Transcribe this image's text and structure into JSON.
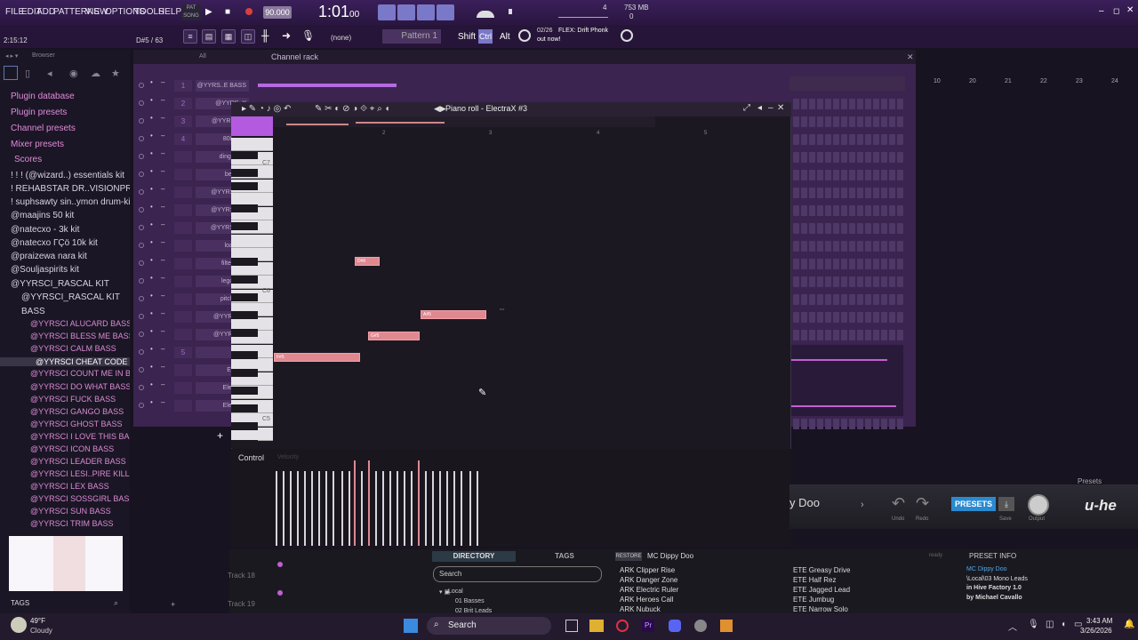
{
  "menu": [
    "FILE",
    "EDIT",
    "ADD",
    "PATTERNS",
    "VIEW",
    "OPTIONS",
    "TOOLS",
    "HELP"
  ],
  "transport": {
    "tempo": "90.000",
    "time": "1:01",
    "time_sub": "00",
    "pattern": "Pattern 1",
    "cpu": "753 MB",
    "cpu2": "0",
    "voices": "4",
    "hint_count": "02/26",
    "hint_text": "FLEX: Drift Phonk",
    "hint_sub": "out now!",
    "shift": "Shift",
    "ctrl": "Ctrl",
    "alt": "Alt",
    "none": "(none)",
    "song_time": "2:15:12",
    "key_pos": "D#5 / 63",
    "pat_label": "PAT",
    "song_label": "SONG"
  },
  "browser": {
    "title": "Browser",
    "all": "All",
    "items": [
      "Plugin database",
      "Plugin presets",
      "Channel presets",
      "Mixer presets",
      "Scores",
      "! ! ! (@wizard..) essentials kit",
      "! REHABSTAR DR..VISIONPROD1",
      "! suphsawty sin..ymon drum-kit",
      "@maajins 50 kit",
      "@natecxo - 3k kit",
      "@natecxo ГÇö 10k kit",
      "@praizewa nara kit",
      "@Souljaspirits kit",
      "@YYRSCI_RASCAL KIT",
      "@YYRSCI_RASCAL KIT",
      "BASS",
      "@YYRSCI ALUCARD BASS",
      "@YYRSCI BLESS ME BASS",
      "@YYRSCI CALM BASS",
      "@YYRSCI CHEAT CODE BASS",
      "@YYRSCI COUNT ME IN BASS",
      "@YYRSCI DO WHAT BASS",
      "@YYRSCI FUCK BASS",
      "@YYRSCI GANGO BASS",
      "@YYRSCI GHOST BASS",
      "@YYRSCI I LOVE THIS BASS",
      "@YYRSCI ICON BASS",
      "@YYRSCI LEADER BASS",
      "@YYRSCI LESI..PIRE KILLERS",
      "@YYRSCI LEX BASS",
      "@YYRSCI SOSSGIRL BASS",
      "@YYRSCI SUN BASS",
      "@YYRSCI TRIM BASS"
    ],
    "tags": "TAGS"
  },
  "channelrack": {
    "title": "Channel rack",
    "channels": [
      {
        "n": "1",
        "name": "@YYRS..E BASS"
      },
      {
        "n": "2",
        "name": "@YYRS..Y"
      },
      {
        "n": "3",
        "name": "@YYRSC..L"
      },
      {
        "n": "4",
        "name": "808 Sna"
      },
      {
        "n": "",
        "name": "dingalo..a"
      },
      {
        "n": "",
        "name": "benji sn"
      },
      {
        "n": "",
        "name": "@YYRS..EN"
      },
      {
        "n": "",
        "name": "@YYRSC..B"
      },
      {
        "n": "",
        "name": "@YYRSC..D"
      },
      {
        "n": "",
        "name": "loaf sna"
      },
      {
        "n": "",
        "name": "filtered cl"
      },
      {
        "n": "",
        "name": "lego fallir"
      },
      {
        "n": "",
        "name": "pitchic..hi"
      },
      {
        "n": "",
        "name": "@YYRSCI.."
      },
      {
        "n": "",
        "name": "@YYRSC..["
      },
      {
        "n": "5",
        "name": "Hive"
      },
      {
        "n": "",
        "name": "Electra"
      },
      {
        "n": "",
        "name": "ElectraX"
      },
      {
        "n": "",
        "name": "ElectraX"
      }
    ],
    "bar_numbers": [
      "10",
      "20",
      "21",
      "22",
      "23",
      "24"
    ]
  },
  "pianoroll": {
    "title": "Piano roll - ElectraX #3",
    "bars": [
      "2",
      "3",
      "4",
      "5"
    ],
    "octaves": [
      "C7",
      "C6",
      "C5"
    ],
    "control": "Control",
    "velocity": "Velocity",
    "notes": [
      {
        "label": "D#6"
      },
      {
        "label": "A#5"
      },
      {
        "label": "G#5"
      },
      {
        "label": "F#5"
      }
    ]
  },
  "plugin": {
    "preset": "y Doo",
    "undo": "Undo",
    "redo": "Redo",
    "presets": "PRESETS",
    "save": "Save",
    "output": "Output",
    "logo": "u-he",
    "presets_label": "Presets"
  },
  "lower": {
    "track18": "Track 18",
    "track19": "Track 19",
    "directory": "DIRECTORY",
    "tags": "TAGS",
    "restore": "RESTORE",
    "current": "MC Dippy Doo",
    "search": "Search",
    "local": "Local",
    "folder1": "01 Basses",
    "folder2": "02 Brit Leads",
    "list1": [
      "ARK Clipper Rise",
      "ARK Danger Zone",
      "ARK Electric Ruler",
      "ARK Heroes Call",
      "ARK Nubuck"
    ],
    "list2": [
      "ETE Greasy Drive",
      "ETE Half Rez",
      "ETE Jagged Lead",
      "ETE Jumbug",
      "ETE Narrow Solo"
    ],
    "info_title": "PRESET INFO",
    "ready": "ready",
    "info": [
      "MC Dippy Doo",
      "\\Local\\03 Mono Leads",
      "in Hive Factory 1.0",
      "by Michael Cavallo"
    ]
  },
  "taskbar": {
    "temp": "49°F",
    "weather": "Cloudy",
    "search": "Search",
    "time": "3:43 AM",
    "date": "3/26/2026"
  }
}
